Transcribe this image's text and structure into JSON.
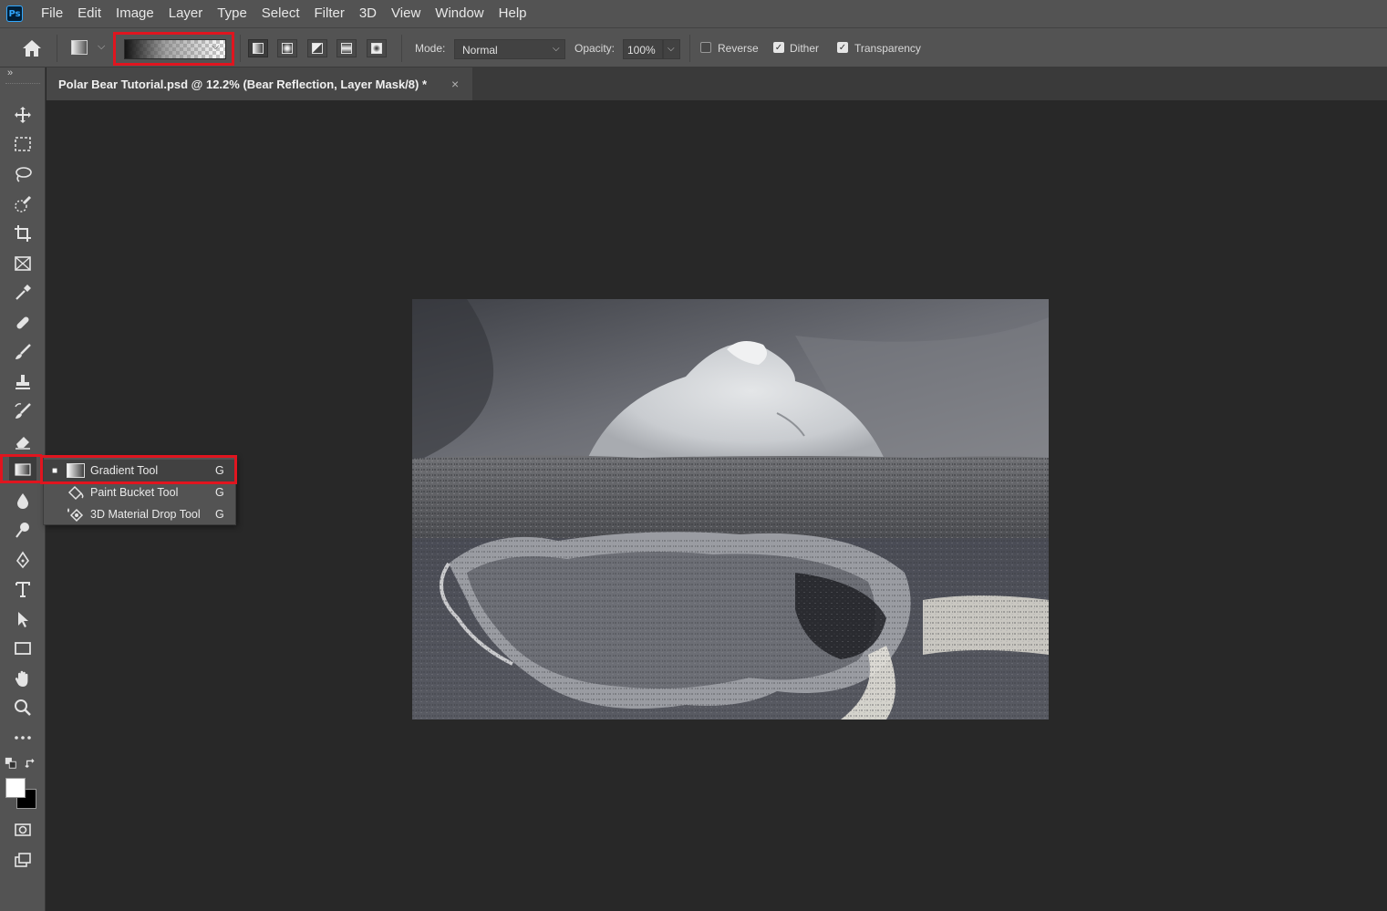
{
  "app": {
    "logo": "Ps"
  },
  "menu": [
    "File",
    "Edit",
    "Image",
    "Layer",
    "Type",
    "Select",
    "Filter",
    "3D",
    "View",
    "Window",
    "Help"
  ],
  "options": {
    "mode_label": "Mode:",
    "mode_value": "Normal",
    "opacity_label": "Opacity:",
    "opacity_value": "100%",
    "reverse_label": "Reverse",
    "reverse_checked": false,
    "dither_label": "Dither",
    "dither_checked": true,
    "transparency_label": "Transparency",
    "transparency_checked": true
  },
  "document": {
    "tab_title": "Polar Bear Tutorial.psd @ 12.2% (Bear Reflection, Layer Mask/8) *",
    "close_glyph": "×"
  },
  "toolbar": {
    "collapse_glyph": "»"
  },
  "flyout": {
    "items": [
      {
        "name": "Gradient Tool",
        "shortcut": "G",
        "active": true,
        "bullet": "■"
      },
      {
        "name": "Paint Bucket Tool",
        "shortcut": "G",
        "active": false,
        "bullet": ""
      },
      {
        "name": "3D Material Drop Tool",
        "shortcut": "G",
        "active": false,
        "bullet": ""
      }
    ]
  },
  "colors": {
    "highlight": "#e0151f",
    "foreground": "#ffffff",
    "background": "#000000"
  }
}
